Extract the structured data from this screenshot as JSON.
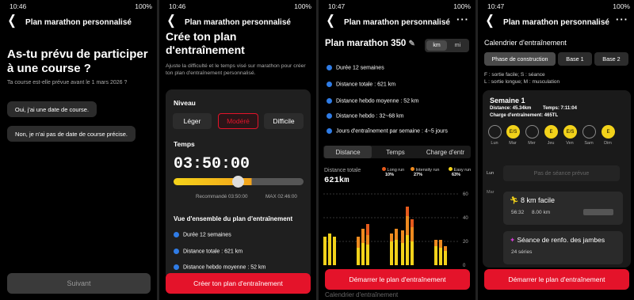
{
  "status": {
    "t1": "10:46",
    "t2": "10:46",
    "t3": "10:47",
    "t4": "10:47",
    "battery": "100%"
  },
  "header_title": "Plan marathon personnalisé",
  "s1": {
    "question": "As-tu prévu de participer à une course ?",
    "sub": "Ta course est-elle prévue avant le 1 mars 2026 ?",
    "opt_yes": "Oui, j'ai une date de course.",
    "opt_no": "Non, je n'ai pas de date de course précise.",
    "next": "Suivant"
  },
  "s2": {
    "title": "Crée ton plan d'entraînement",
    "desc": "Ajuste la difficulté et le temps visé sur marathon pour créer ton plan d'entraînement personnalisé.",
    "level_label": "Niveau",
    "levels": [
      "Léger",
      "Modéré",
      "Difficile"
    ],
    "time_label": "Temps",
    "time_value": "03:50:00",
    "slider_level": 0.62,
    "rec": "Recommandé 03:50:00",
    "max": "MAX 02:46:00",
    "overview_label": "Vue d'ensemble du plan d'entraînement",
    "overview": [
      "Durée 12 semaines",
      "Distance totale : 621 km",
      "Distance hebdo moyenne : 52 km"
    ],
    "create": "Créer ton plan d'entraînement"
  },
  "s3": {
    "title": "Plan marathon 350",
    "units": [
      "km",
      "mi"
    ],
    "items": [
      "Durée 12 semaines",
      "Distance totale : 621 km",
      "Distance hebdo moyenne : 52 km",
      "Distance hebdo : 32~68 km",
      "Jours d'entraînement par semaine : 4~5 jours"
    ],
    "tabs": [
      "Distance",
      "Temps",
      "Charge d'entr"
    ],
    "dist_label": "Distance totale",
    "dist_value": "621km",
    "legend": [
      {
        "name": "Long run",
        "pct": "10%",
        "color": "#e55a1c"
      },
      {
        "name": "Intensity run",
        "pct": "27%",
        "color": "#ee8a1f"
      },
      {
        "name": "Easy run",
        "pct": "63%",
        "color": "#f2d21a"
      }
    ],
    "yticks": [
      "60",
      "40",
      "20",
      "0"
    ],
    "start": "Démarrer le plan d'entraînement",
    "calendar": "Calendrier d'entraînement"
  },
  "s4": {
    "title": "Calendrier d'entraînement",
    "phases": [
      "Phase de construction",
      "Base 1",
      "Base 2"
    ],
    "legend1": "F : sortie facile; S : séance",
    "legend2": "L : sortie longue; M : musculation",
    "week": "Semaine 1",
    "dist": "Distance: 45.34km",
    "time": "Temps: 7:11:04",
    "charge": "Charge d'entraînement: 465TL",
    "days": [
      {
        "l": "",
        "d": "Lun"
      },
      {
        "l": "E/S",
        "d": "Mar"
      },
      {
        "l": "",
        "d": "Mer"
      },
      {
        "l": "E",
        "d": "Jeu"
      },
      {
        "l": "E/S",
        "d": "Ven"
      },
      {
        "l": "",
        "d": "Sam"
      },
      {
        "l": "E",
        "d": "Dim"
      }
    ],
    "side_lun": "Lun",
    "side_mar": "Mar",
    "none": "Pas de séance prévue",
    "act1_title": "8 km facile",
    "act1_time": "56:32",
    "act1_dist": "8.00 km",
    "act2_title": "Séance de renfo. des jambes",
    "act2_count": "24",
    "act2_unit": "séries",
    "start": "Démarrer le plan d'entraînement"
  }
}
